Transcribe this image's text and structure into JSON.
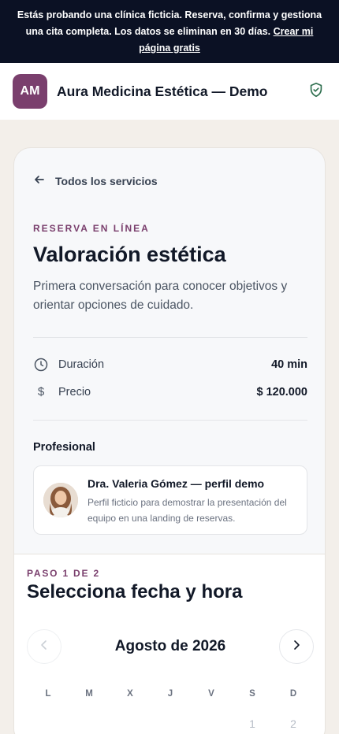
{
  "banner": {
    "text": "Estás probando una clínica ficticia. Reserva, confirma y gestiona una cita completa. Los datos se eliminan en 30 días. ",
    "link": "Crear mi página gratis"
  },
  "header": {
    "initials": "AM",
    "title": "Aura Medicina Estética — Demo",
    "icon": "shield-check-icon"
  },
  "service": {
    "back_label": "Todos los servicios",
    "eyebrow": "RESERVA EN LÍNEA",
    "title": "Valoración estética",
    "description": "Primera conversación para conocer objetivos y orientar opciones de cuidado.",
    "duration_label": "Duración",
    "duration_value": "40 min",
    "price_symbol": "$",
    "price_label": "Precio",
    "price_value": "$ 120.000"
  },
  "professional": {
    "heading": "Profesional",
    "name": "Dra. Valeria Gómez — perfil demo",
    "description": "Perfil ficticio para demostrar la presentación del equipo en una landing de reservas."
  },
  "booking": {
    "step": "PASO 1 DE 2",
    "title": "Selecciona fecha y hora",
    "month": "Agosto de 2026",
    "weekdays": [
      "L",
      "M",
      "X",
      "J",
      "V",
      "S",
      "D"
    ],
    "first_days": [
      "1",
      "2"
    ]
  },
  "colors": {
    "banner_bg": "#0b1124",
    "brand": "#7a3f6d",
    "shield": "#2f6f4f"
  }
}
